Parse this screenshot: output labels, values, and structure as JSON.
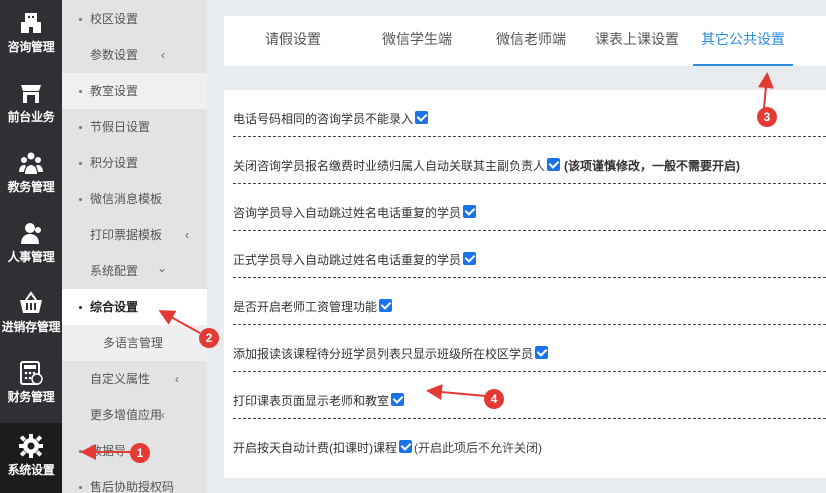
{
  "rail": [
    {
      "icon": "building-icon",
      "label": "咨询管理"
    },
    {
      "icon": "store-icon",
      "label": "前台业务"
    },
    {
      "icon": "people-group-icon",
      "label": "教务管理"
    },
    {
      "icon": "person-icon",
      "label": "人事管理"
    },
    {
      "icon": "basket-icon",
      "label": "进销存管理"
    },
    {
      "icon": "calculator-icon",
      "label": "财务管理"
    },
    {
      "icon": "gear-icon",
      "label": "系统设置"
    }
  ],
  "submenu": [
    {
      "label": "校区设置",
      "chev": ""
    },
    {
      "label": "参数设置",
      "chev": "‹"
    },
    {
      "label": "教室设置",
      "chev": ""
    },
    {
      "label": "节假日设置",
      "chev": ""
    },
    {
      "label": "积分设置",
      "chev": ""
    },
    {
      "label": "微信消息模板",
      "chev": ""
    },
    {
      "label": "打印票据模板",
      "chev": "‹"
    },
    {
      "label": "系统配置",
      "chev": "⌄"
    },
    {
      "label": "综合设置",
      "chev": ""
    },
    {
      "label": "多语言管理",
      "chev": ""
    },
    {
      "label": "自定义属性",
      "chev": "‹"
    },
    {
      "label": "更多增值应用",
      "chev": "‹"
    },
    {
      "label": "数据导",
      "chev": ""
    },
    {
      "label": "售后协助授权码",
      "chev": ""
    }
  ],
  "tabs": [
    "请假设置",
    "微信学生端",
    "微信老师端",
    "课表上课设置",
    "其它公共设置"
  ],
  "settings": [
    {
      "text": "电话号码相同的咨询学员不能录入",
      "checked": true,
      "note_bold": "",
      "note": ""
    },
    {
      "text": "关闭咨询学员报名缴费时业绩归属人自动关联其主副负责人",
      "checked": true,
      "note_bold": "(该项谨慎修改，一般不需要开启)",
      "note": ""
    },
    {
      "text": "咨询学员导入自动跳过姓名电话重复的学员",
      "checked": true,
      "note_bold": "",
      "note": ""
    },
    {
      "text": "正式学员导入自动跳过姓名电话重复的学员",
      "checked": true,
      "note_bold": "",
      "note": ""
    },
    {
      "text": "是否开启老师工资管理功能",
      "checked": true,
      "note_bold": "",
      "note": ""
    },
    {
      "text": "添加报读该课程待分班学员列表只显示班级所在校区学员",
      "checked": true,
      "note_bold": "",
      "note": ""
    },
    {
      "text": "打印课表页面显示老师和教室",
      "checked": true,
      "note_bold": "",
      "note": ""
    },
    {
      "text": "开启按天自动计费(扣课时)课程",
      "checked": true,
      "note_bold": "",
      "note": "(开启此项后不允许关闭)"
    }
  ],
  "annotations": [
    "1",
    "2",
    "3",
    "4"
  ],
  "colors": {
    "accent": "#2b8ce0",
    "checkbox": "#1a73e8",
    "annotation": "#e53935",
    "rail": "#2f3033"
  }
}
